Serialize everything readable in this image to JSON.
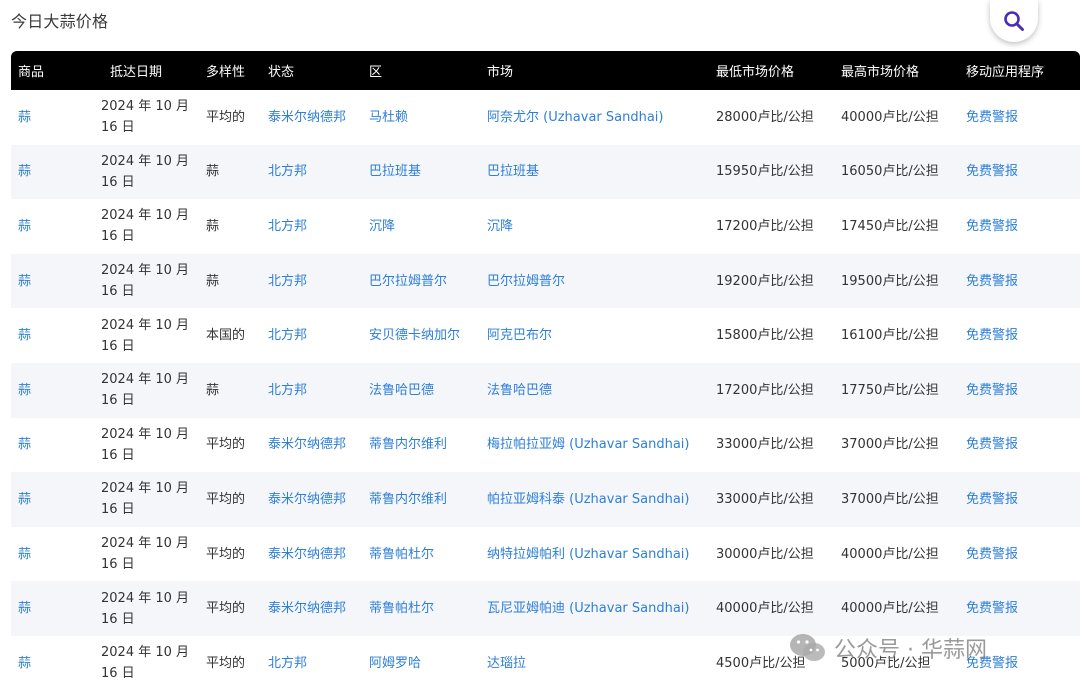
{
  "page": {
    "title": "今日大蒜价格"
  },
  "search": {
    "icon": "search-icon",
    "icon_color": "#4a2fb5"
  },
  "table": {
    "headers": [
      "商品",
      "抵达日期",
      "多样性",
      "状态",
      "区",
      "市场",
      "最低市场价格",
      "最高市场价格",
      "移动应用程序"
    ],
    "rows": [
      {
        "commodity": "蒜",
        "date": "2024 年 10 月 16 日",
        "variety": "平均的",
        "state": "泰米尔纳德邦",
        "district": "马杜赖",
        "market": "阿奈尤尔 (Uzhavar Sandhai)",
        "min_price": "28000卢比/公担",
        "max_price": "40000卢比/公担",
        "app": "免费警报"
      },
      {
        "commodity": "蒜",
        "date": "2024 年 10 月 16 日",
        "variety": "蒜",
        "state": "北方邦",
        "district": "巴拉班基",
        "market": "巴拉班基",
        "min_price": "15950卢比/公担",
        "max_price": "16050卢比/公担",
        "app": "免费警报"
      },
      {
        "commodity": "蒜",
        "date": "2024 年 10 月 16 日",
        "variety": "蒜",
        "state": "北方邦",
        "district": "沉降",
        "market": "沉降",
        "min_price": "17200卢比/公担",
        "max_price": "17450卢比/公担",
        "app": "免费警报"
      },
      {
        "commodity": "蒜",
        "date": "2024 年 10 月 16 日",
        "variety": "蒜",
        "state": "北方邦",
        "district": "巴尔拉姆普尔",
        "market": "巴尔拉姆普尔",
        "min_price": "19200卢比/公担",
        "max_price": "19500卢比/公担",
        "app": "免费警报"
      },
      {
        "commodity": "蒜",
        "date": "2024 年 10 月 16 日",
        "variety": "本国的",
        "state": "北方邦",
        "district": "安贝德卡纳加尔",
        "market": "阿克巴布尔",
        "min_price": "15800卢比/公担",
        "max_price": "16100卢比/公担",
        "app": "免费警报"
      },
      {
        "commodity": "蒜",
        "date": "2024 年 10 月 16 日",
        "variety": "蒜",
        "state": "北方邦",
        "district": "法鲁哈巴德",
        "market": "法鲁哈巴德",
        "min_price": "17200卢比/公担",
        "max_price": "17750卢比/公担",
        "app": "免费警报"
      },
      {
        "commodity": "蒜",
        "date": "2024 年 10 月 16 日",
        "variety": "平均的",
        "state": "泰米尔纳德邦",
        "district": "蒂鲁内尔维利",
        "market": "梅拉帕拉亚姆 (Uzhavar Sandhai)",
        "min_price": "33000卢比/公担",
        "max_price": "37000卢比/公担",
        "app": "免费警报"
      },
      {
        "commodity": "蒜",
        "date": "2024 年 10 月 16 日",
        "variety": "平均的",
        "state": "泰米尔纳德邦",
        "district": "蒂鲁内尔维利",
        "market": "帕拉亚姆科泰 (Uzhavar Sandhai)",
        "min_price": "33000卢比/公担",
        "max_price": "37000卢比/公担",
        "app": "免费警报"
      },
      {
        "commodity": "蒜",
        "date": "2024 年 10 月 16 日",
        "variety": "平均的",
        "state": "泰米尔纳德邦",
        "district": "蒂鲁帕杜尔",
        "market": "纳特拉姆帕利 (Uzhavar Sandhai)",
        "min_price": "30000卢比/公担",
        "max_price": "40000卢比/公担",
        "app": "免费警报"
      },
      {
        "commodity": "蒜",
        "date": "2024 年 10 月 16 日",
        "variety": "平均的",
        "state": "泰米尔纳德邦",
        "district": "蒂鲁帕杜尔",
        "market": "瓦尼亚姆帕迪 (Uzhavar Sandhai)",
        "min_price": "40000卢比/公担",
        "max_price": "40000卢比/公担",
        "app": "免费警报"
      },
      {
        "commodity": "蒜",
        "date": "2024 年 10 月 16 日",
        "variety": "平均的",
        "state": "北方邦",
        "district": "阿姆罗哈",
        "market": "达瑙拉",
        "min_price": "4500卢比/公担",
        "max_price": "5000卢比/公担",
        "app": "免费警报"
      }
    ]
  },
  "colors": {
    "header_bg": "#000000",
    "header_text": "#ffffff",
    "link": "#2d7fd7",
    "row_alt": "#f5f6fa"
  },
  "watermark": {
    "text": "公众号 · 华蒜网",
    "icon": "wechat-icon"
  }
}
